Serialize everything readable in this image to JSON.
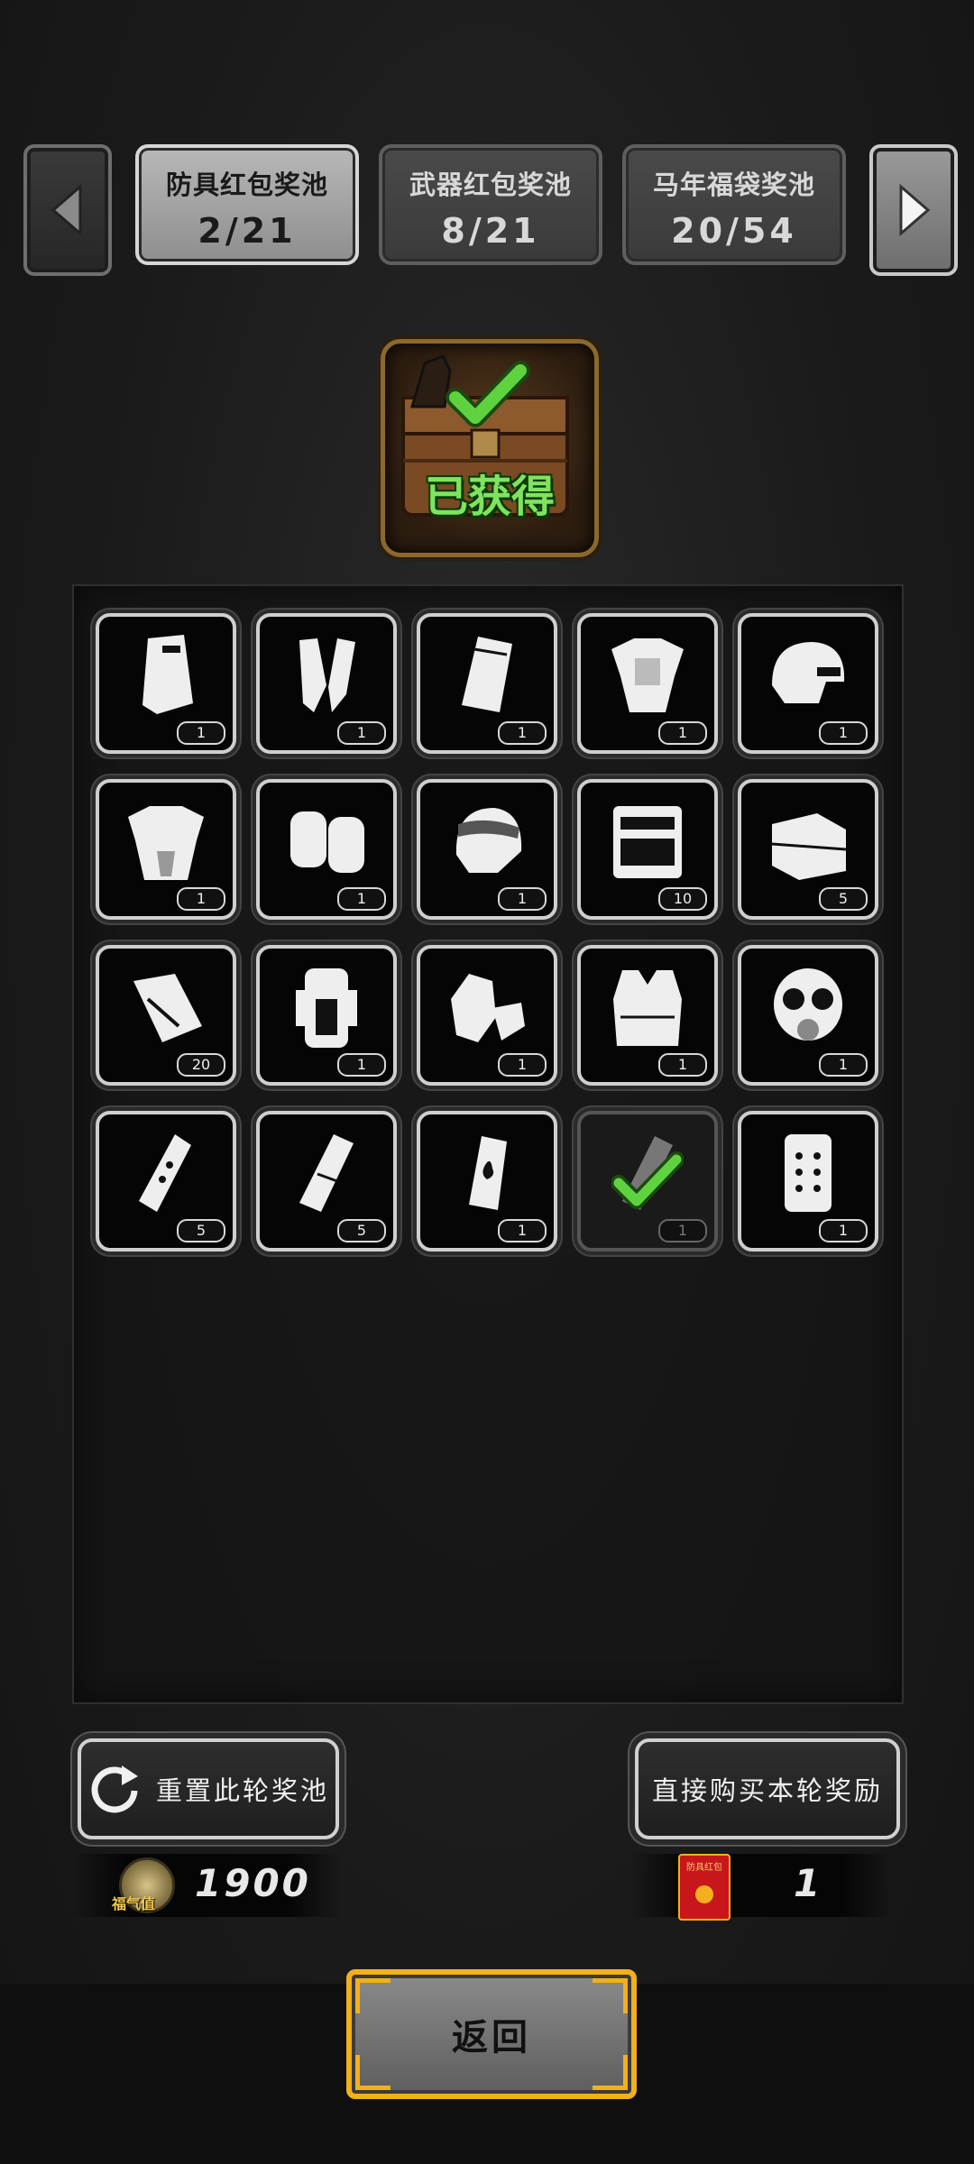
{
  "nav": {
    "prev_icon": "triangle-left-icon",
    "next_icon": "triangle-right-icon"
  },
  "tabs": [
    {
      "title": "防具红包奖池",
      "count": "2/21",
      "active": true
    },
    {
      "title": "武器红包奖池",
      "count": "8/21",
      "active": false
    },
    {
      "title": "马年福袋奖池",
      "count": "20/54",
      "active": false
    }
  ],
  "status": {
    "label": "已获得",
    "icon": "horse-chest-icon"
  },
  "items": [
    {
      "icon": "riot-shield-icon",
      "qty": "1",
      "claimed": false
    },
    {
      "icon": "arm-guards-icon",
      "qty": "1",
      "claimed": false
    },
    {
      "icon": "armor-plate-icon",
      "qty": "1",
      "claimed": false
    },
    {
      "icon": "shoulder-armor-icon",
      "qty": "1",
      "claimed": false
    },
    {
      "icon": "tactical-helmet-icon",
      "qty": "1",
      "claimed": false
    },
    {
      "icon": "heavy-armor-icon",
      "qty": "1",
      "claimed": false
    },
    {
      "icon": "knee-pads-icon",
      "qty": "1",
      "claimed": false
    },
    {
      "icon": "visor-helmet-icon",
      "qty": "1",
      "claimed": false
    },
    {
      "icon": "tool-case-icon",
      "qty": "10",
      "claimed": false
    },
    {
      "icon": "toolbox-icon",
      "qty": "5",
      "claimed": false
    },
    {
      "icon": "repair-kit-icon",
      "qty": "20",
      "claimed": false
    },
    {
      "icon": "backpack-icon",
      "qty": "1",
      "claimed": false
    },
    {
      "icon": "gloves-icon",
      "qty": "1",
      "claimed": false
    },
    {
      "icon": "vest-icon",
      "qty": "1",
      "claimed": false
    },
    {
      "icon": "gas-mask-icon",
      "qty": "1",
      "claimed": false
    },
    {
      "icon": "flashbang-icon",
      "qty": "5",
      "claimed": false
    },
    {
      "icon": "smoke-grenade-icon",
      "qty": "5",
      "claimed": false
    },
    {
      "icon": "incendiary-grenade-icon",
      "qty": "1",
      "claimed": false
    },
    {
      "icon": "frag-grenade-icon",
      "qty": "1",
      "claimed": true
    },
    {
      "icon": "ballistic-shield-icon",
      "qty": "1",
      "claimed": false
    }
  ],
  "actions": {
    "reset_label": "重置此轮奖池",
    "reset_icon": "refresh-icon",
    "buy_label": "直接购买本轮奖励"
  },
  "currency": {
    "luck_badge": "福气值",
    "luck_value": "1900",
    "envelope_badge": "防具红包",
    "envelope_value": "1"
  },
  "back_label": "返回",
  "colors": {
    "accent_gold": "#f2b01c",
    "check_green": "#5fd33f"
  }
}
